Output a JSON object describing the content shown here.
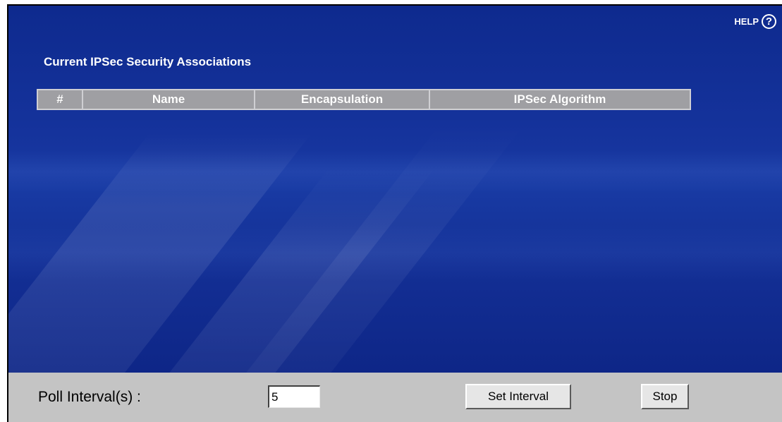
{
  "help": {
    "label": "HELP",
    "icon": "question-circle-icon",
    "icon_glyph": "?"
  },
  "section": {
    "title": "Current IPSec Security Associations"
  },
  "table": {
    "columns": [
      "#",
      "Name",
      "Encapsulation",
      "IPSec Algorithm"
    ],
    "rows": []
  },
  "poll": {
    "label": "Poll Interval(s) :",
    "value": "5"
  },
  "buttons": {
    "set_interval": "Set Interval",
    "stop": "Stop"
  },
  "colors": {
    "panel_background": "#15339c",
    "table_header": "#9f9fa3",
    "bottom_bar": "#c4c4c4"
  }
}
